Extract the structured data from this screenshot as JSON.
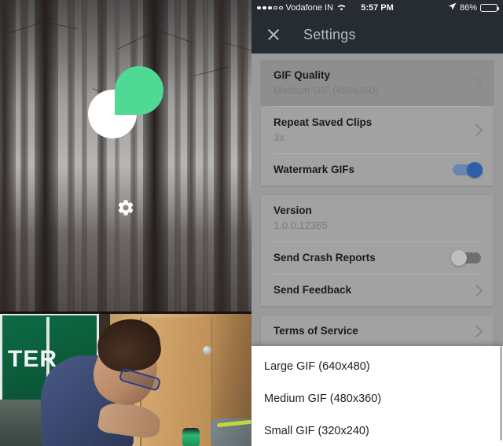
{
  "status_bar": {
    "signal_dots_filled": 3,
    "signal_dots_empty": 2,
    "carrier": "Vodafone IN",
    "wifi_icon": "wifi-icon",
    "time": "5:57 PM",
    "location_icon": "location-arrow-icon",
    "battery_percent": "86%",
    "battery_level": 86
  },
  "app_bar": {
    "close_icon": "close-icon",
    "title": "Settings"
  },
  "left_panel": {
    "logo_name": "app-logo",
    "logo_colors": {
      "leaf_white": "#ffffff",
      "leaf_green": "#4ed995"
    },
    "gear_icon": "gear-icon",
    "top_photo_alt": "foggy pine forest",
    "bottom_photo_alt": "person in blue shirt kneeling by a wooden door",
    "sign_text": "TER"
  },
  "settings": {
    "groups": [
      {
        "rows": [
          {
            "title": "GIF Quality",
            "subtitle": "Medium GIF (480x360)",
            "accessory": "chevron",
            "selected": true
          },
          {
            "title": "Repeat Saved Clips",
            "subtitle": "3x",
            "accessory": "chevron",
            "selected": false
          },
          {
            "title": "Watermark GIFs",
            "subtitle": "",
            "accessory": "switch",
            "switch_on": true,
            "selected": false
          }
        ]
      },
      {
        "rows": [
          {
            "title": "Version",
            "subtitle": "1.0.0.12365",
            "accessory": "none",
            "selected": false
          },
          {
            "title": "Send Crash Reports",
            "subtitle": "",
            "accessory": "switch",
            "switch_on": false,
            "selected": false
          },
          {
            "title": "Send Feedback",
            "subtitle": "",
            "accessory": "chevron",
            "selected": false
          }
        ]
      },
      {
        "rows": [
          {
            "title": "Terms of Service",
            "subtitle": "",
            "accessory": "chevron",
            "selected": false
          }
        ]
      }
    ]
  },
  "dialog": {
    "options": [
      "Large GIF (640x480)",
      "Medium GIF (480x360)",
      "Small GIF (320x240)"
    ]
  },
  "colors": {
    "app_bar_bg": "#262c32",
    "page_bg": "#9a9a9a",
    "card_bg": "#a2a2a2",
    "switch_on": "#2f5fa8",
    "dialog_bg": "#ffffff"
  }
}
